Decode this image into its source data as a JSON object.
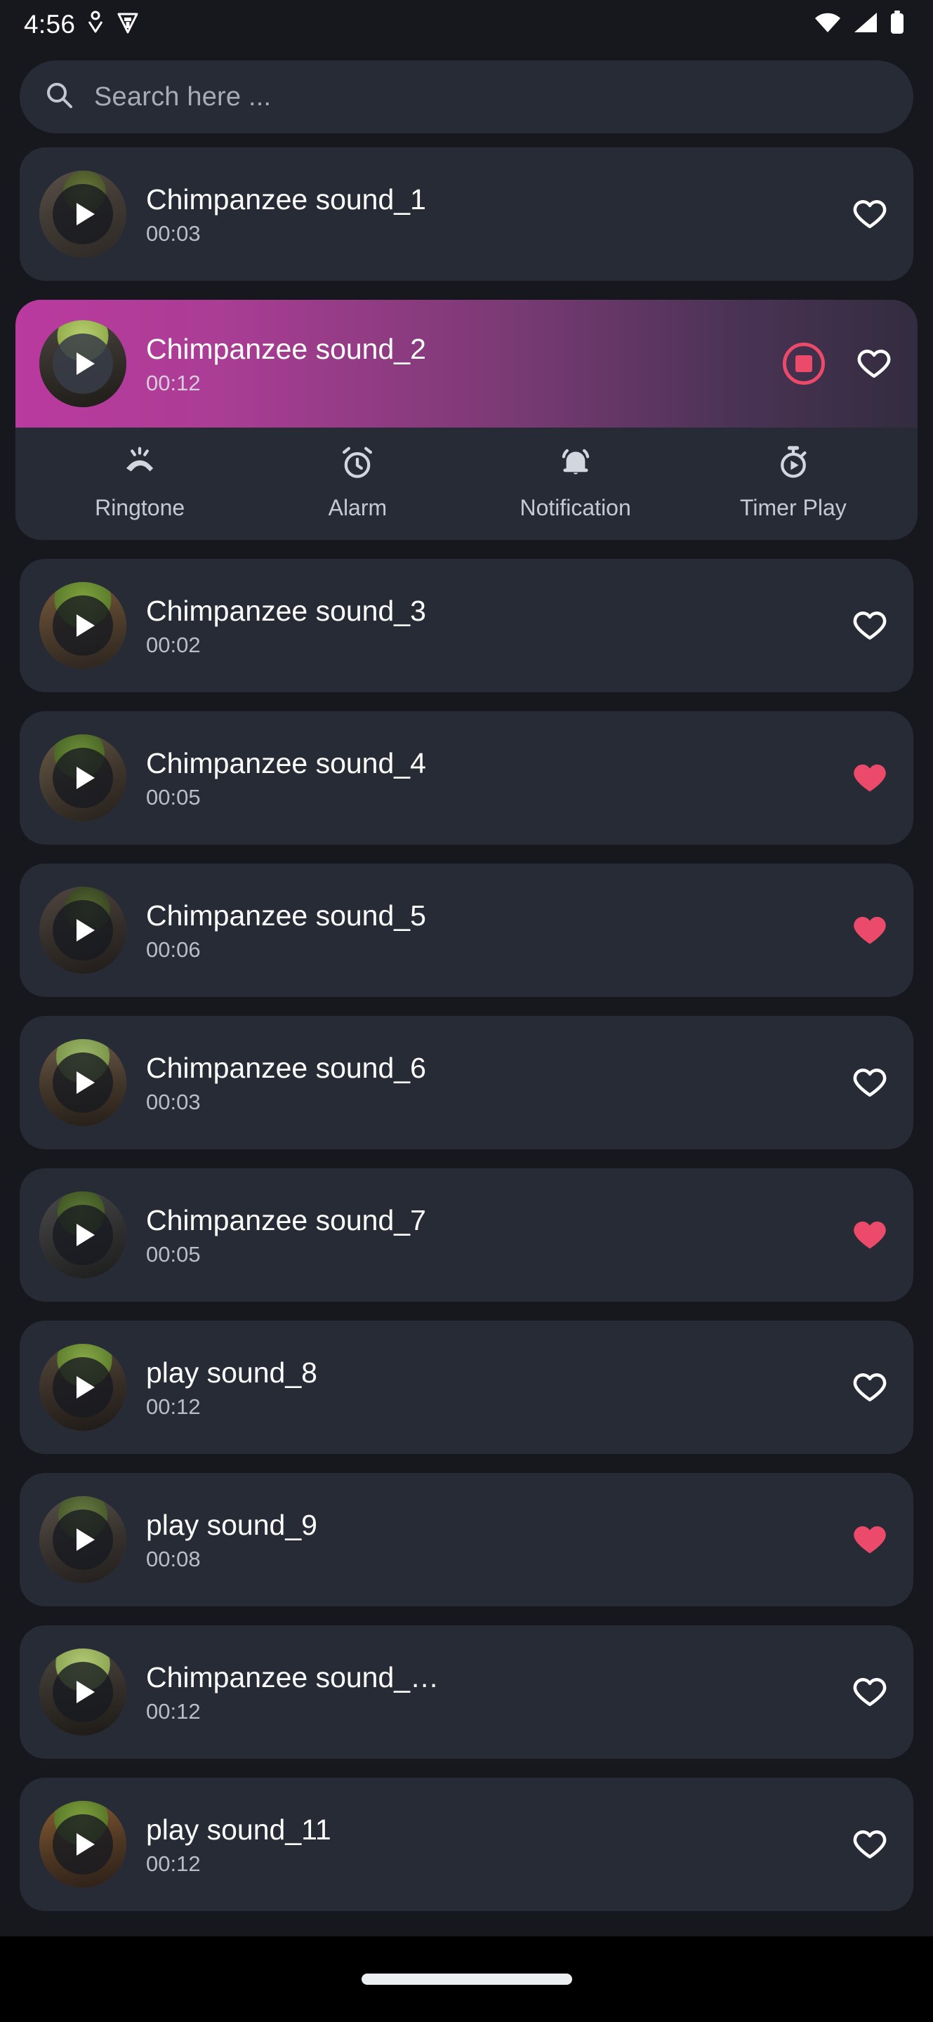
{
  "statusbar": {
    "time": "4:56",
    "left_icons": [
      "location-pin-icon",
      "shield-alert-icon"
    ],
    "right_icons": [
      "wifi-icon",
      "cellular-signal-icon",
      "battery-icon"
    ]
  },
  "search": {
    "placeholder": "Search here ...",
    "value": "",
    "icon": "search-icon"
  },
  "colors": {
    "page_bg": "#16181d",
    "card_bg": "#272b35",
    "accent_selected_start": "#ba3a9f",
    "accent_selected_end": "#332c3f",
    "favorite_filled": "#ec4a6a",
    "stop_button": "#ec4a6a",
    "text_primary": "#ffffff",
    "text_secondary": "#b9bdc7"
  },
  "action_panel": {
    "actions": [
      {
        "label": "Ringtone",
        "icon": "vibrate-phone-icon"
      },
      {
        "label": "Alarm",
        "icon": "alarm-clock-icon"
      },
      {
        "label": "Notification",
        "icon": "notification-bell-icon"
      },
      {
        "label": "Timer Play",
        "icon": "stopwatch-play-icon"
      }
    ]
  },
  "sounds": [
    {
      "title": "Chimpanzee sound_1",
      "duration": "00:03",
      "favorite": false,
      "selected": false,
      "playing": false
    },
    {
      "title": "Chimpanzee sound_2",
      "duration": "00:12",
      "favorite": false,
      "selected": true,
      "playing": true
    },
    {
      "title": "Chimpanzee sound_3",
      "duration": "00:02",
      "favorite": false,
      "selected": false,
      "playing": false
    },
    {
      "title": "Chimpanzee sound_4",
      "duration": "00:05",
      "favorite": true,
      "selected": false,
      "playing": false
    },
    {
      "title": "Chimpanzee sound_5",
      "duration": "00:06",
      "favorite": true,
      "selected": false,
      "playing": false
    },
    {
      "title": "Chimpanzee sound_6",
      "duration": "00:03",
      "favorite": false,
      "selected": false,
      "playing": false
    },
    {
      "title": "Chimpanzee sound_7",
      "duration": "00:05",
      "favorite": true,
      "selected": false,
      "playing": false
    },
    {
      "title": "play sound_8",
      "duration": "00:12",
      "favorite": false,
      "selected": false,
      "playing": false
    },
    {
      "title": "play sound_9",
      "duration": "00:08",
      "favorite": true,
      "selected": false,
      "playing": false
    },
    {
      "title": "Chimpanzee sound_…",
      "duration": "00:12",
      "favorite": false,
      "selected": false,
      "playing": false
    },
    {
      "title": "play sound_11",
      "duration": "00:12",
      "favorite": false,
      "selected": false,
      "playing": false
    }
  ],
  "navbar": {
    "home_indicator": "home-indicator-pill"
  }
}
